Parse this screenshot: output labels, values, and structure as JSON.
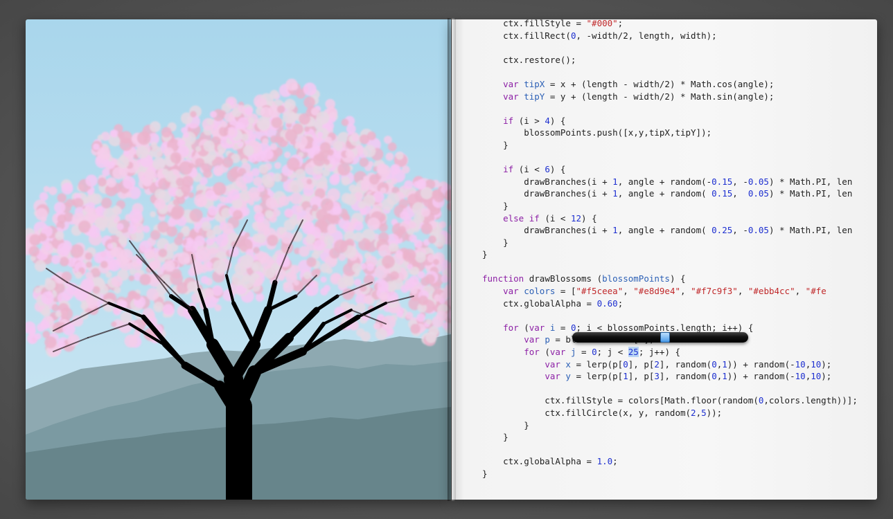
{
  "colors": {
    "sky_top": "#a9d6ec",
    "sky_bottom": "#cde7f3",
    "mountain_far": "#8ea9b1",
    "mountain_mid": "#7b9aa2",
    "mountain_near": "#67858b",
    "trunk": "#000000",
    "blossoms": [
      "#f5ceea",
      "#e8d9e4",
      "#f7c9f3",
      "#ebb4cc"
    ]
  },
  "code_lines": [
    [
      {
        "t": "    ctx.fillStyle = "
      },
      {
        "t": "\"#000\"",
        "c": "str"
      },
      {
        "t": ";"
      }
    ],
    [
      {
        "t": "    ctx.fillRect("
      },
      {
        "t": "0",
        "c": "num"
      },
      {
        "t": ", -width/2, length, width);"
      }
    ],
    [
      {
        "t": ""
      }
    ],
    [
      {
        "t": "    ctx.restore();"
      }
    ],
    [
      {
        "t": ""
      }
    ],
    [
      {
        "t": "    "
      },
      {
        "t": "var",
        "c": "kw"
      },
      {
        "t": " "
      },
      {
        "t": "tipX",
        "c": "var"
      },
      {
        "t": " = x + (length - width/2) * Math.cos(angle);"
      }
    ],
    [
      {
        "t": "    "
      },
      {
        "t": "var",
        "c": "kw"
      },
      {
        "t": " "
      },
      {
        "t": "tipY",
        "c": "var"
      },
      {
        "t": " = y + (length - width/2) * Math.sin(angle);"
      }
    ],
    [
      {
        "t": ""
      }
    ],
    [
      {
        "t": "    "
      },
      {
        "t": "if",
        "c": "kw"
      },
      {
        "t": " (i > "
      },
      {
        "t": "4",
        "c": "num"
      },
      {
        "t": ") {"
      }
    ],
    [
      {
        "t": "        blossomPoints.push([x,y,tipX,tipY]);"
      }
    ],
    [
      {
        "t": "    }"
      }
    ],
    [
      {
        "t": ""
      }
    ],
    [
      {
        "t": "    "
      },
      {
        "t": "if",
        "c": "kw"
      },
      {
        "t": " (i < "
      },
      {
        "t": "6",
        "c": "num"
      },
      {
        "t": ") {"
      }
    ],
    [
      {
        "t": "        drawBranches(i + "
      },
      {
        "t": "1",
        "c": "num"
      },
      {
        "t": ", angle + random(-"
      },
      {
        "t": "0.15",
        "c": "num"
      },
      {
        "t": ", -"
      },
      {
        "t": "0.05",
        "c": "num"
      },
      {
        "t": ") * Math.PI, len"
      }
    ],
    [
      {
        "t": "        drawBranches(i + "
      },
      {
        "t": "1",
        "c": "num"
      },
      {
        "t": ", angle + random( "
      },
      {
        "t": "0.15",
        "c": "num"
      },
      {
        "t": ",  "
      },
      {
        "t": "0.05",
        "c": "num"
      },
      {
        "t": ") * Math.PI, len"
      }
    ],
    [
      {
        "t": "    }"
      }
    ],
    [
      {
        "t": "    "
      },
      {
        "t": "else if",
        "c": "kw"
      },
      {
        "t": " (i < "
      },
      {
        "t": "12",
        "c": "num"
      },
      {
        "t": ") {"
      }
    ],
    [
      {
        "t": "        drawBranches(i + "
      },
      {
        "t": "1",
        "c": "num"
      },
      {
        "t": ", angle + random( "
      },
      {
        "t": "0.25",
        "c": "num"
      },
      {
        "t": ", -"
      },
      {
        "t": "0.05",
        "c": "num"
      },
      {
        "t": ") * Math.PI, len"
      }
    ],
    [
      {
        "t": "    }"
      }
    ],
    [
      {
        "t": "}"
      }
    ],
    [
      {
        "t": ""
      }
    ],
    [
      {
        "t": "function",
        "c": "kw"
      },
      {
        "t": " drawBlossoms ("
      },
      {
        "t": "blossomPoints",
        "c": "var"
      },
      {
        "t": ") {"
      }
    ],
    [
      {
        "t": "    "
      },
      {
        "t": "var",
        "c": "kw"
      },
      {
        "t": " "
      },
      {
        "t": "colors",
        "c": "var"
      },
      {
        "t": " = ["
      },
      {
        "t": "\"#f5ceea\"",
        "c": "str"
      },
      {
        "t": ", "
      },
      {
        "t": "\"#e8d9e4\"",
        "c": "str"
      },
      {
        "t": ", "
      },
      {
        "t": "\"#f7c9f3\"",
        "c": "str"
      },
      {
        "t": ", "
      },
      {
        "t": "\"#ebb4cc\"",
        "c": "str"
      },
      {
        "t": ", "
      },
      {
        "t": "\"#fe",
        "c": "str"
      }
    ],
    [
      {
        "t": "    ctx.globalAlpha = "
      },
      {
        "t": "0.60",
        "c": "num"
      },
      {
        "t": ";"
      }
    ],
    [
      {
        "t": ""
      }
    ],
    [
      {
        "t": "    "
      },
      {
        "t": "for",
        "c": "kw"
      },
      {
        "t": " ("
      },
      {
        "t": "var",
        "c": "kw"
      },
      {
        "t": " "
      },
      {
        "t": "i",
        "c": "var"
      },
      {
        "t": " = "
      },
      {
        "t": "0",
        "c": "num"
      },
      {
        "t": "; i < blossomPoints.length; i++) {"
      }
    ],
    [
      {
        "t": "        "
      },
      {
        "t": "var",
        "c": "kw"
      },
      {
        "t": " "
      },
      {
        "t": "p",
        "c": "var"
      },
      {
        "t": " = blossomPoints[i];"
      }
    ],
    [
      {
        "t": "        "
      },
      {
        "t": "for",
        "c": "kw"
      },
      {
        "t": " ("
      },
      {
        "t": "var",
        "c": "kw"
      },
      {
        "t": " "
      },
      {
        "t": "j",
        "c": "var"
      },
      {
        "t": " = "
      },
      {
        "t": "0",
        "c": "num"
      },
      {
        "t": "; j < "
      },
      {
        "t": "25",
        "c": "sel"
      },
      {
        "t": "; j++) {"
      }
    ],
    [
      {
        "t": "            "
      },
      {
        "t": "var",
        "c": "kw"
      },
      {
        "t": " "
      },
      {
        "t": "x",
        "c": "var"
      },
      {
        "t": " = lerp(p["
      },
      {
        "t": "0",
        "c": "num"
      },
      {
        "t": "], p["
      },
      {
        "t": "2",
        "c": "num"
      },
      {
        "t": "], random("
      },
      {
        "t": "0",
        "c": "num"
      },
      {
        "t": ","
      },
      {
        "t": "1",
        "c": "num"
      },
      {
        "t": ")) + random(-"
      },
      {
        "t": "10",
        "c": "num"
      },
      {
        "t": ","
      },
      {
        "t": "10",
        "c": "num"
      },
      {
        "t": ");"
      }
    ],
    [
      {
        "t": "            "
      },
      {
        "t": "var",
        "c": "kw"
      },
      {
        "t": " "
      },
      {
        "t": "y",
        "c": "var"
      },
      {
        "t": " = lerp(p["
      },
      {
        "t": "1",
        "c": "num"
      },
      {
        "t": "], p["
      },
      {
        "t": "3",
        "c": "num"
      },
      {
        "t": "], random("
      },
      {
        "t": "0",
        "c": "num"
      },
      {
        "t": ","
      },
      {
        "t": "1",
        "c": "num"
      },
      {
        "t": ")) + random(-"
      },
      {
        "t": "10",
        "c": "num"
      },
      {
        "t": ","
      },
      {
        "t": "10",
        "c": "num"
      },
      {
        "t": ");"
      }
    ],
    [
      {
        "t": ""
      }
    ],
    [
      {
        "t": "            ctx.fillStyle = colors[Math.floor(random("
      },
      {
        "t": "0",
        "c": "num"
      },
      {
        "t": ",colors.length))];"
      }
    ],
    [
      {
        "t": "            ctx.fillCircle(x, y, random("
      },
      {
        "t": "2",
        "c": "num"
      },
      {
        "t": ","
      },
      {
        "t": "5",
        "c": "num"
      },
      {
        "t": "));"
      }
    ],
    [
      {
        "t": "        }"
      }
    ],
    [
      {
        "t": "    }"
      }
    ],
    [
      {
        "t": ""
      }
    ],
    [
      {
        "t": "    ctx.globalAlpha = "
      },
      {
        "t": "1.0",
        "c": "num"
      },
      {
        "t": ";"
      }
    ],
    [
      {
        "t": "}"
      }
    ]
  ],
  "scrubber": {
    "value": 25
  }
}
